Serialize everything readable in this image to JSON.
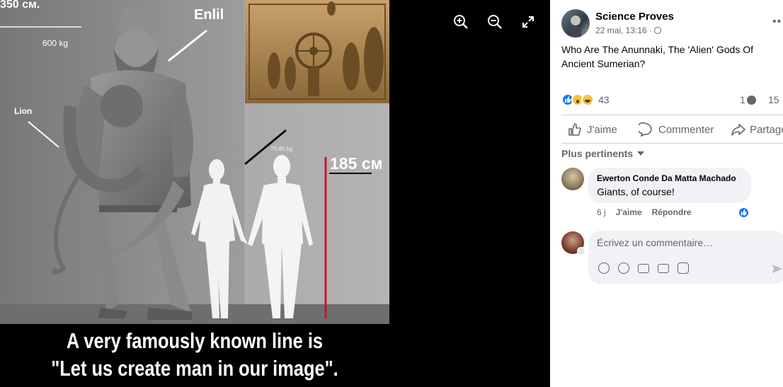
{
  "photo": {
    "height_label": "350 см.",
    "weight_label": "600 kg",
    "giant_label": "Enlil",
    "lion_label": "Lion",
    "human_weight": "75-80 kg",
    "human_height": "185 см",
    "caption_line1": "A very famously known line is",
    "caption_line2": "\"Let us create man in our image\"."
  },
  "viewer": {
    "zoom_in_icon": "zoom-in-icon",
    "zoom_out_icon": "zoom-out-icon",
    "fullscreen_icon": "fullscreen-icon"
  },
  "post": {
    "author": "Science Proves",
    "timestamp": "22 mai, 13:16 ·",
    "privacy_icon": "globe-icon",
    "more_icon": "more-icon",
    "text": "Who Are The Anunnaki, The 'Alien' Gods Of Ancient Sumerian?",
    "reactions_count": "43",
    "comments_count": "1",
    "shares_count": "15"
  },
  "actions": {
    "like": "J'aime",
    "comment": "Commenter",
    "share": "Partager"
  },
  "sort": {
    "label": "Plus pertinents"
  },
  "comment": {
    "author": "Ewerton Conde Da Matta Machado",
    "text": "Giants, of course!",
    "age": "6 j",
    "like": "J'aime",
    "reply": "Répondre"
  },
  "composer": {
    "placeholder": "Écrivez un commentaire…"
  },
  "colors": {
    "like_blue": "#1877f2",
    "panel_bg": "#ffffff",
    "bubble_bg": "#f0f2f5",
    "text": "#050505",
    "muted": "#65676b"
  }
}
